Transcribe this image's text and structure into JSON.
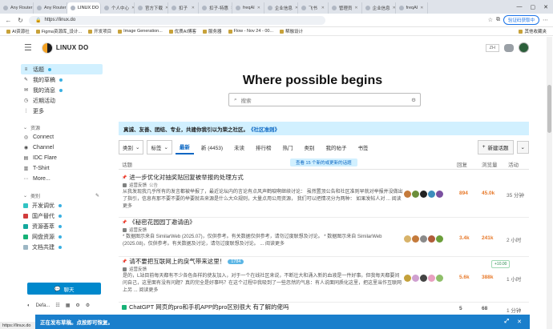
{
  "browser": {
    "tabs": [
      {
        "label": "Any Router",
        "active": false
      },
      {
        "label": "Any Router",
        "active": false
      },
      {
        "label": "LINUX DO",
        "active": true
      },
      {
        "label": "个人中心",
        "active": false
      },
      {
        "label": "官方下载",
        "active": false
      },
      {
        "label": "扣子",
        "active": false
      },
      {
        "label": "扣子-特惠",
        "active": false
      },
      {
        "label": "freqAI",
        "active": false
      },
      {
        "label": "企业信息",
        "active": false
      },
      {
        "label": "飞书",
        "active": false
      },
      {
        "label": "管理员",
        "active": false
      },
      {
        "label": "企业信息",
        "active": false
      },
      {
        "label": "freqAI",
        "active": false
      }
    ],
    "url": "https://linux.do",
    "sync_label": "验证码获取中",
    "bookmarks": [
      "AI资源社",
      "Figma资源库_设计...",
      "开发项目",
      "Image Generation...",
      "优质AI博客",
      "服务器",
      "Flow - Nov 24 - 00...",
      "帮融设计"
    ],
    "bookmarks_right": "其他收藏夹",
    "status_url": "https://linux.do"
  },
  "header": {
    "logo_text": "LINUX DO",
    "lang": "ZH"
  },
  "sidebar": {
    "items": [
      {
        "label": "话题",
        "icon": "≡",
        "dot": true,
        "active": true
      },
      {
        "label": "我的草稿",
        "icon": "✎",
        "dot": true
      },
      {
        "label": "我的消息",
        "icon": "✉",
        "dot": true
      },
      {
        "label": "近期活动",
        "icon": "◷",
        "dot": false
      },
      {
        "label": "更多",
        "icon": "⋮",
        "dot": false
      }
    ],
    "resources_title": "资源",
    "resources": [
      {
        "label": "Connect",
        "icon": "◎"
      },
      {
        "label": "Channel",
        "icon": "◉"
      },
      {
        "label": "IDC Flare",
        "icon": "▤"
      },
      {
        "label": "T-Shirt",
        "icon": "▥"
      },
      {
        "label": "More...",
        "icon": "⋯"
      }
    ],
    "categories_title": "类别",
    "categories": [
      {
        "label": "开发调优",
        "color": "#32c3c3",
        "dot": true
      },
      {
        "label": "国产替代",
        "color": "#d13b3b",
        "dot": true
      },
      {
        "label": "资源荟萃",
        "color": "#12a89d",
        "dot": true
      },
      {
        "label": "网盘资源",
        "color": "#16b176",
        "dot": true
      },
      {
        "label": "文档共建",
        "color": "#9cb6c4",
        "dot": true
      }
    ],
    "chat_label": "聊天",
    "bottom_label": "Defa..."
  },
  "main": {
    "hero": "Where possible begins",
    "search_placeholder": "搜索",
    "banner_text": "真诚、友善、团结、专业，共建你我引以为荣之社区。",
    "banner_link": "《社区准则》",
    "nav": {
      "category_dd": "类别",
      "tag_dd": "标签",
      "links": [
        {
          "label": "最新",
          "active": true
        },
        {
          "label": "新 (4453)"
        },
        {
          "label": "未读"
        },
        {
          "label": "排行榜"
        },
        {
          "label": "热门"
        },
        {
          "label": "类别"
        },
        {
          "label": "我的帖子"
        },
        {
          "label": "书签"
        }
      ],
      "new_topic": "新建话题"
    },
    "table": {
      "col_topic": "话题",
      "col_replies": "回复",
      "col_views": "浏览量",
      "col_activity": "活动",
      "new_topics_pill": "查看 15 个新的或更新的话题"
    },
    "topics": [
      {
        "title": "进一步优化对抽奖贴回复被举报的处理方式",
        "pinned": true,
        "category": "运营反馈",
        "cat_color": "#808281",
        "tag": "公告",
        "excerpt": "从我发现我几乎所有的发言都被举报了，最近论坛内的言论有点风声鹤唳啊继续讨论： 虽然置顶公告和社区准则早就对举报并没做出了指引，信息有那不要不要的举要就去来源是什么大众规则，大量点用公用资源， 我们可以把情况分为两种： 如果发帖人对 ... 阅读更多",
        "posters": [
          "#c47a3b",
          "#6b8e3a",
          "#222222",
          "#3c8dbc",
          "#7a4fa0"
        ],
        "replies": "894",
        "views": "45.0k",
        "activity": "35 分钟"
      },
      {
        "title": "《秘密花园园丁邀请函》",
        "pinned": true,
        "category": "运营反馈",
        "cat_color": "#808281",
        "tag": "",
        "excerpt": "* 数据图示来自 SimilarWeb (2025.07)，仅供参考。有关数据仅供参考，请勿过度联想及讨论。 * 数据图示来自 SimilarWeb (2025.08)，仅供参考。有关数据及讨论，请勿过度联想及讨论。 ... 阅读更多",
        "posters": [
          "#d8b36a",
          "#c47a3b",
          "#8a8a8a",
          "#b05c3a",
          "#6b9e3a"
        ],
        "replies": "3.4k",
        "views": "241k",
        "activity": "2 小时"
      },
      {
        "title": "请不要把互联网上的戾气带来这里！",
        "pinned": true,
        "badge": "1784",
        "category": "运营反馈",
        "cat_color": "#808281",
        "tag": "",
        "excerpt": "是的，L站目前每天都有不少各色各样的使友加入，对于一个在线社区来说，不断壮大和涌入新的血液是一件好事。但我每天都要间问自己，这里面有没有问题？真的完全是好事吗？在这个过程中我吸到了一些忽然的气息：有人说面同质化这里，把这里当作互联网上另 ... 阅读更多",
        "posters": [
          "#c4a13b",
          "#cfa0d0",
          "#444444",
          "#e8a0c0",
          "#8fbf6a"
        ],
        "replies": "5.6k",
        "views": "388k",
        "activity": "1 小时",
        "heat": "+10.00"
      },
      {
        "title": "ChatGPT 网页的pro和手机APP的pro区别很大 有了解的佬吗",
        "pinned": false,
        "category": "",
        "cat_color": "#16b176",
        "tag": "",
        "excerpt": "",
        "posters": [],
        "replies": "5",
        "views": "68",
        "activity": "1 分钟"
      }
    ]
  },
  "draft_bar": {
    "text": "正在发布草稿。点按即可恢复。"
  }
}
